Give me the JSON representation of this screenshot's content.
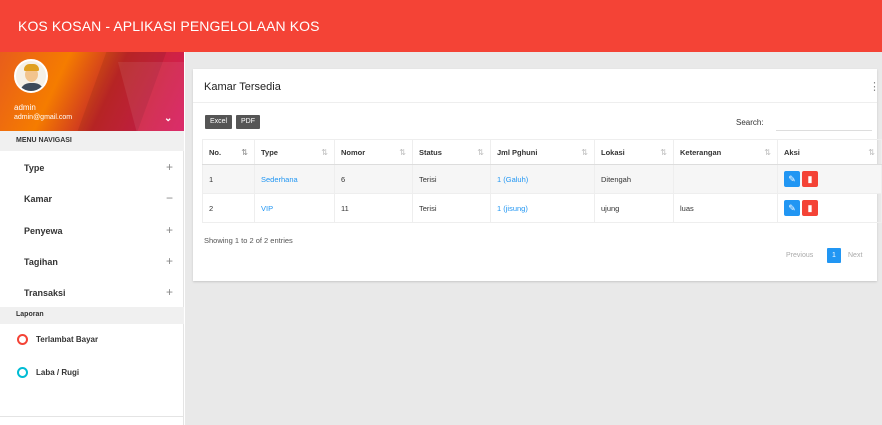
{
  "app": {
    "title": "KOS KOSAN - APLIKASI PENGELOLAAN KOS"
  },
  "user": {
    "name": "admin",
    "email": "admin@gmail.com"
  },
  "menu": {
    "header": "MENU NAVIGASI",
    "items": [
      {
        "label": "Type",
        "sign": "+"
      },
      {
        "label": "Kamar",
        "sign": "−"
      },
      {
        "label": "Penyewa",
        "sign": "+"
      },
      {
        "label": "Tagihan",
        "sign": "+"
      },
      {
        "label": "Transaksi",
        "sign": "+"
      }
    ],
    "report_header": "Laporan",
    "reports": [
      {
        "label": "Terlambat Bayar",
        "color": "#f44336"
      },
      {
        "label": "Laba / Rugi",
        "color": "#00bcd4"
      }
    ]
  },
  "card": {
    "title": "Kamar Tersedia",
    "buttons": {
      "excel": "Excel",
      "pdf": "PDF"
    },
    "search_label": "Search:",
    "search_value": "",
    "columns": [
      "No.",
      "Type",
      "Nomor",
      "Status",
      "Jml Pghuni",
      "Lokasi",
      "Keterangan",
      "Aksi"
    ],
    "rows": [
      {
        "no": "1",
        "type": "Sederhana",
        "nomor": "6",
        "status": "Terisi",
        "jml": "1 (Galuh)",
        "lokasi": "Ditengah",
        "keterangan": ""
      },
      {
        "no": "2",
        "type": "VIP",
        "nomor": "11",
        "status": "Terisi",
        "jml": "1 (jisung)",
        "lokasi": "ujung",
        "keterangan": "luas"
      }
    ],
    "showing": "Showing 1 to 2 of 2 entries",
    "pagination": {
      "previous": "Previous",
      "current": "1",
      "next": "Next"
    }
  },
  "colors": {
    "accent": "#f44336",
    "link": "#2196f3"
  }
}
